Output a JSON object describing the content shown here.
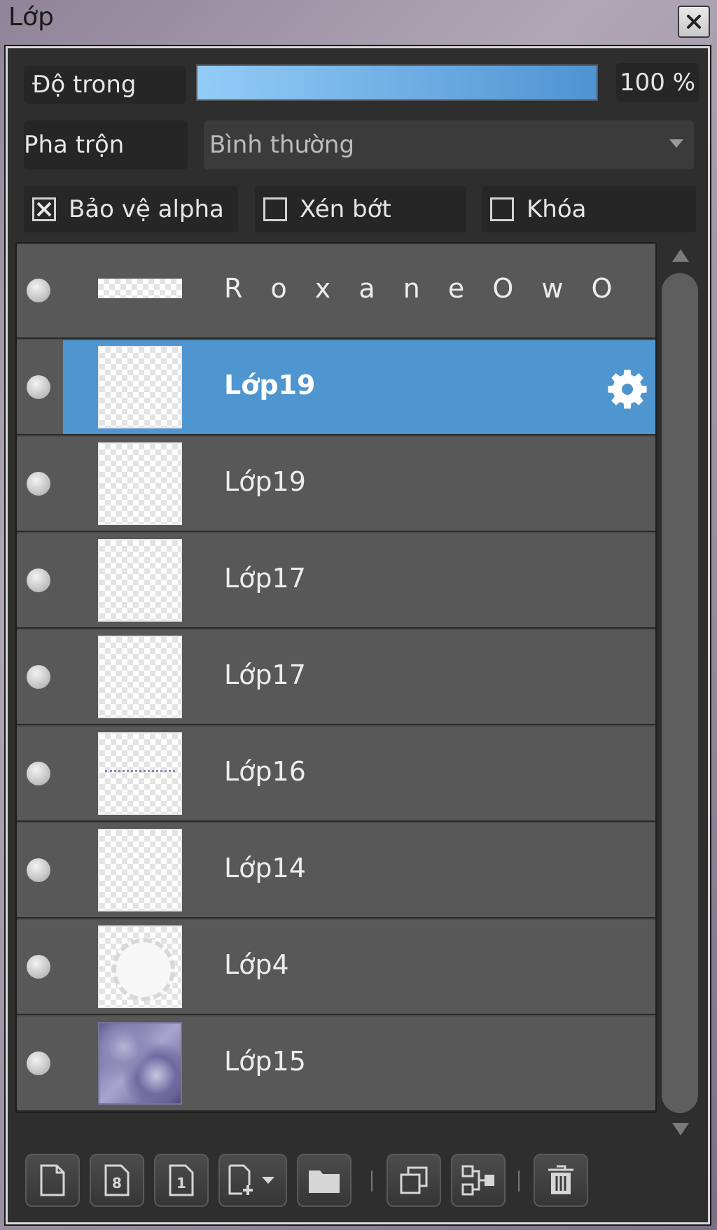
{
  "window": {
    "title": "Lớp"
  },
  "opacity": {
    "label": "Độ trong",
    "value": "100 %",
    "level": 1.0
  },
  "blend": {
    "label": "Pha trộn",
    "selected": "Bình thường"
  },
  "options": [
    {
      "label": "Bảo vệ alpha",
      "checked": true
    },
    {
      "label": "Xén bớt",
      "checked": false
    },
    {
      "label": "Khóa",
      "checked": false
    }
  ],
  "layers": [
    {
      "name": "R o x a n e O w O",
      "selected": false,
      "thumb": "banner"
    },
    {
      "name": "Lớp19",
      "selected": true,
      "thumb": "transparent"
    },
    {
      "name": "Lớp19",
      "selected": false,
      "thumb": "transparent"
    },
    {
      "name": "Lớp17",
      "selected": false,
      "thumb": "transparent"
    },
    {
      "name": "Lớp17",
      "selected": false,
      "thumb": "transparent"
    },
    {
      "name": "Lớp16",
      "selected": false,
      "thumb": "scribble"
    },
    {
      "name": "Lớp14",
      "selected": false,
      "thumb": "transparent"
    },
    {
      "name": "Lớp4",
      "selected": false,
      "thumb": "circle"
    },
    {
      "name": "Lớp15",
      "selected": false,
      "thumb": "photo"
    }
  ],
  "toolbar": {
    "buttons": [
      "new-layer-icon",
      "new-8bit-layer-icon",
      "new-1bit-layer-icon",
      "add-layer-menu-icon",
      "folder-icon",
      "duplicate-layer-icon",
      "merge-down-icon",
      "trash-icon"
    ]
  },
  "colors": {
    "accent": "#4f95cf",
    "panel": "#2e2e2e",
    "row": "#585858"
  }
}
